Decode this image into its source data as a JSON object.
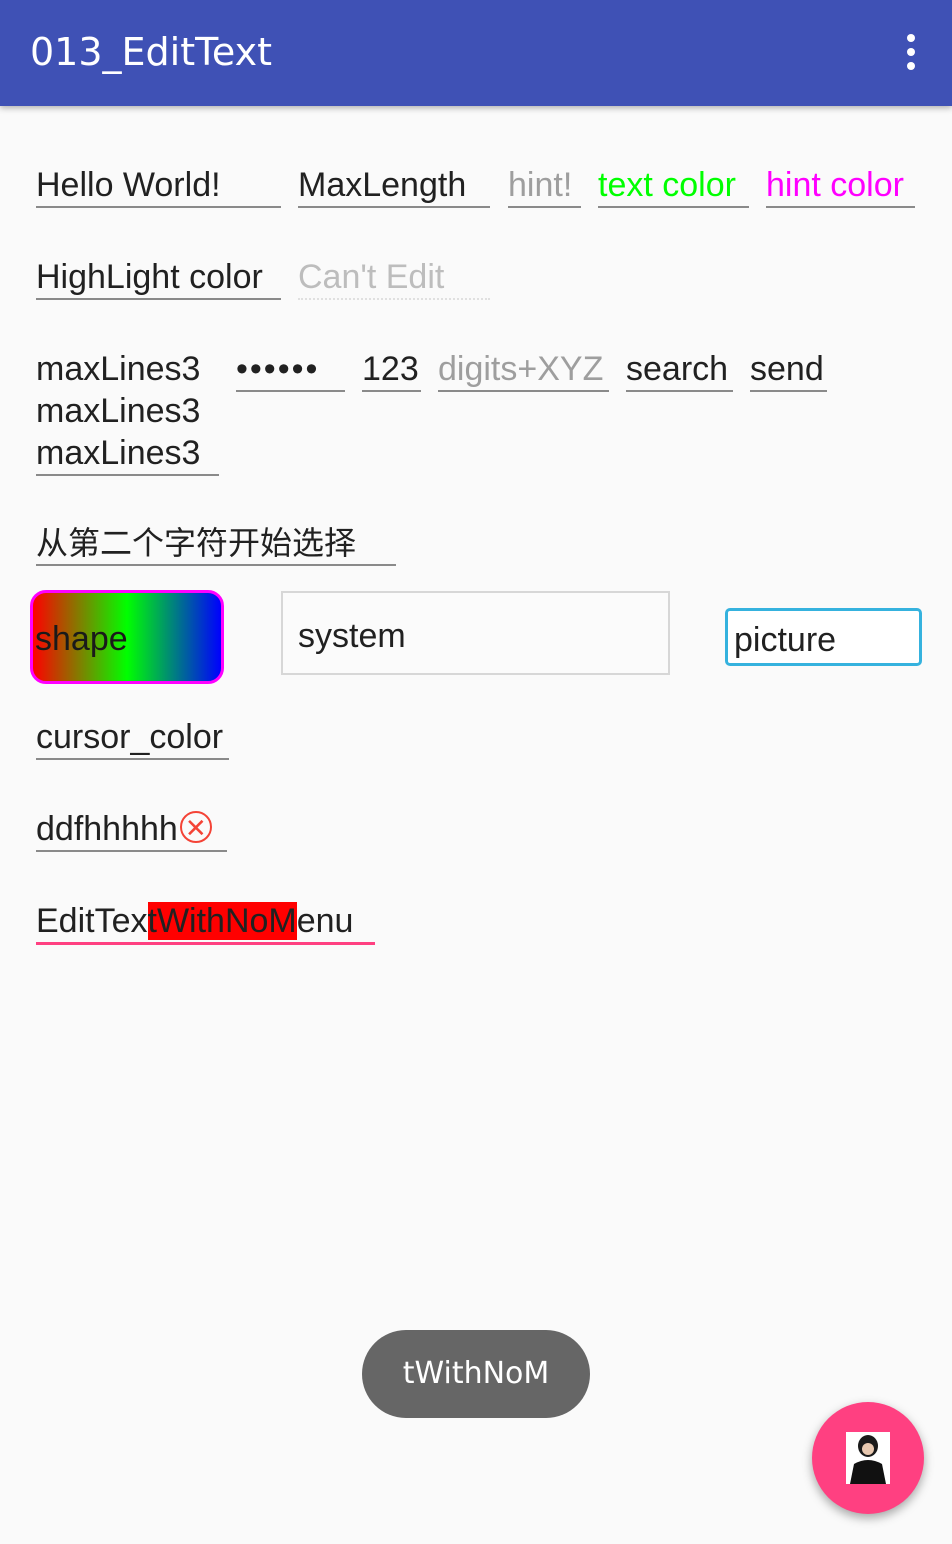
{
  "appbar": {
    "title": "013_EditText",
    "menu_icon": "more-vert-icon"
  },
  "row1": {
    "hello": "Hello World!",
    "maxlength": "MaxLength",
    "hint": "hint!",
    "text_color": "text color",
    "hint_color": "hint color"
  },
  "row2": {
    "highlight": "HighLight color",
    "cant_edit": "Can't Edit"
  },
  "row3": {
    "maxlines": "maxLines3\nmaxLines3\nmaxLines3",
    "password": "••••••",
    "number": "123",
    "digits": "digits+XYZ",
    "search": "search",
    "send": "send"
  },
  "row4": {
    "select_from_second": "从第二个字符开始选择"
  },
  "row5": {
    "shape": "shape",
    "system": "system",
    "picture": "picture"
  },
  "row6": {
    "cursor_color": "cursor_color"
  },
  "row7": {
    "clearable": "ddfhhhhh"
  },
  "row8": {
    "before": "EditTex",
    "selected": "tWithNoM",
    "after": "enu"
  },
  "toast": {
    "text": "tWithNoM"
  },
  "fab": {
    "icon": "avatar-icon"
  },
  "colors": {
    "appbar": "#3f51b5",
    "accent": "#ff4081",
    "text_color": "#00ff00",
    "hint_color": "#ff00ff",
    "selection": "#ff0000"
  }
}
